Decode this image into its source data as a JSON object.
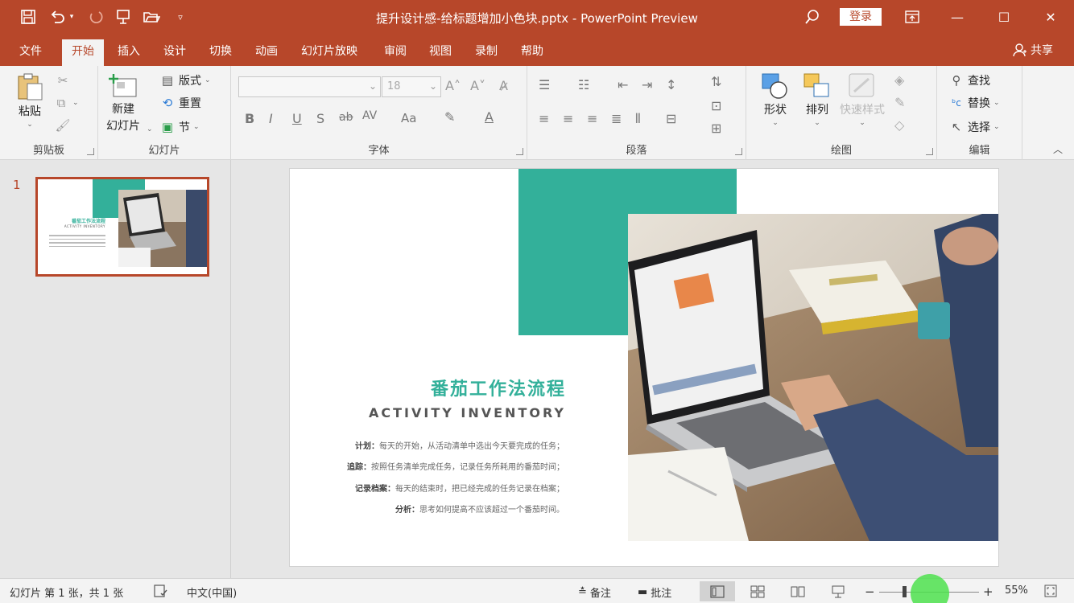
{
  "window": {
    "title": "提升设计感-给标题增加小色块.pptx  -  PowerPoint Preview",
    "login_label": "登录",
    "minimize_label": "—",
    "maximize_label": "☐",
    "close_label": "✕"
  },
  "quick_access": {
    "save_icon": "💾",
    "undo_icon": "↶",
    "redo_icon": "↷",
    "present_icon": "⊼",
    "open_icon": "📂",
    "customize_icon": "▾"
  },
  "tabs": [
    {
      "label": "文件"
    },
    {
      "label": "开始"
    },
    {
      "label": "插入"
    },
    {
      "label": "设计"
    },
    {
      "label": "切换"
    },
    {
      "label": "动画"
    },
    {
      "label": "幻灯片放映"
    },
    {
      "label": "审阅"
    },
    {
      "label": "视图"
    },
    {
      "label": "录制"
    },
    {
      "label": "帮助"
    }
  ],
  "active_tab": "开始",
  "share_label": "共享",
  "ribbon": {
    "clipboard": {
      "label": "剪贴板",
      "paste": "粘贴"
    },
    "slides": {
      "label": "幻灯片",
      "new_slide_1": "新建",
      "new_slide_2": "幻灯片",
      "layout": "版式",
      "reset": "重置",
      "section": "节"
    },
    "font": {
      "label": "字体",
      "font_size": "18"
    },
    "paragraph": {
      "label": "段落"
    },
    "drawing": {
      "label": "绘图",
      "shape": "形状",
      "arrange": "排列",
      "quick_style": "快速样式"
    },
    "editing": {
      "label": "编辑",
      "find": "查找",
      "replace": "替换",
      "select": "选择"
    }
  },
  "thumbnail": {
    "number": "1",
    "title": "番茄工作法流程",
    "subtitle": "ACTIVITY INVENTORY"
  },
  "slide": {
    "title": "番茄工作法流程",
    "subtitle": "ACTIVITY INVENTORY",
    "lines": [
      {
        "label": "计划：",
        "text": "每天的开始，从活动清单中选出今天要完成的任务；"
      },
      {
        "label": "追踪：",
        "text": "按照任务清单完成任务，记录任务所耗用的番茄时间；"
      },
      {
        "label": "记录档案：",
        "text": "每天的结束时，把已经完成的任务记录在档案；"
      },
      {
        "label": "分析：",
        "text": "思考如何提高不应该超过一个番茄时间。"
      }
    ],
    "accent_color": "#33b09a"
  },
  "statusbar": {
    "slide_info": "幻灯片 第 1 张，共 1 张",
    "language": "中文(中国)",
    "notes": "备注",
    "comments": "批注",
    "zoom_out": "−",
    "zoom_in": "+",
    "zoom": "55%",
    "zoom_fraction": 0.55
  },
  "colors": {
    "brand": "#b7472a",
    "ribbon_bg": "#f3f3f3"
  }
}
